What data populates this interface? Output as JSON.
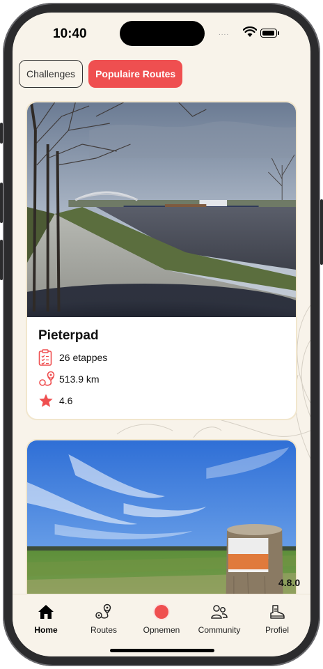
{
  "status_bar": {
    "time": "10:40",
    "signal": "....",
    "icons": [
      "wifi-icon",
      "battery-icon"
    ]
  },
  "tabs": [
    {
      "label": "Challenges",
      "active": false
    },
    {
      "label": "Populaire Routes",
      "active": true
    }
  ],
  "routes": [
    {
      "name": "Pieterpad",
      "stages": "26 etappes",
      "distance": "513.9 km",
      "rating": "4.6",
      "image": "canal-path-photo"
    },
    {
      "image": "meadow-marker-post-photo"
    }
  ],
  "version": "4.8.0",
  "bottom_nav": [
    {
      "label": "Home",
      "icon": "home-icon",
      "active": true
    },
    {
      "label": "Routes",
      "icon": "route-icon",
      "active": false
    },
    {
      "label": "Opnemen",
      "icon": "record-icon",
      "active": false
    },
    {
      "label": "Community",
      "icon": "community-icon",
      "active": false
    },
    {
      "label": "Profiel",
      "icon": "boot-icon",
      "active": false
    }
  ],
  "colors": {
    "accent": "#ef4f50",
    "background": "#f8f3ea",
    "card_border": "#f1e6cd"
  }
}
